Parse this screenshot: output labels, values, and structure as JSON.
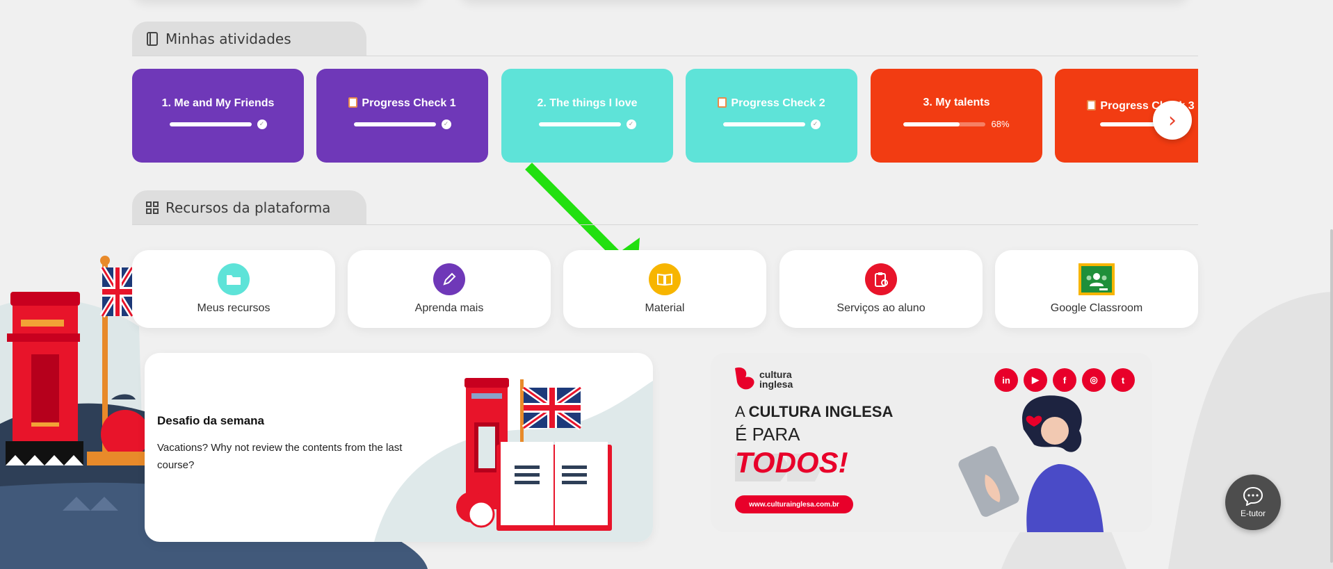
{
  "sections": {
    "activities_title": "Minhas atividades",
    "resources_title": "Recursos da plataforma"
  },
  "activities": [
    {
      "label": "1. Me and My Friends",
      "progress": 1.0,
      "done": true,
      "color": "#6f38b8",
      "doc": false
    },
    {
      "label": "Progress Check 1",
      "progress": 1.0,
      "done": true,
      "color": "#6f38b8",
      "doc": true
    },
    {
      "label": "2. The things I love",
      "progress": 1.0,
      "done": true,
      "color": "#5ee3d8",
      "doc": false
    },
    {
      "label": "Progress Check 2",
      "progress": 1.0,
      "done": true,
      "color": "#5ee3d8",
      "doc": true
    },
    {
      "label": "3. My talents",
      "progress": 0.68,
      "done": false,
      "percent_label": "68%",
      "color": "#f23c12",
      "doc": false
    },
    {
      "label": "Progress Check 3",
      "progress": 1.0,
      "done": false,
      "color": "#f23c12",
      "doc": true
    }
  ],
  "resources": [
    {
      "label": "Meus recursos",
      "icon": "folder-icon",
      "color": "#5ee3d8"
    },
    {
      "label": "Aprenda mais",
      "icon": "pencil-icon",
      "color": "#6f38b8"
    },
    {
      "label": "Material",
      "icon": "book-icon",
      "color": "#f7b500"
    },
    {
      "label": "Serviços ao aluno",
      "icon": "clipboard-icon",
      "color": "#e8142a"
    },
    {
      "label": "Google Classroom",
      "icon": "google-classroom-icon",
      "color": "#1f8f3a"
    }
  ],
  "challenge": {
    "title": "Desafio da semana",
    "text": "Vacations? Why not review the contents from the last course?"
  },
  "banner": {
    "logo_line1": "cultura",
    "logo_line2": "inglesa",
    "line1_prefix": "A ",
    "line1_bold": "CULTURA INGLESA",
    "line2": "É PARA",
    "line3": "TODOS!",
    "url": "www.culturainglesa.com.br",
    "socials": [
      "in",
      "▶",
      "f",
      "◎",
      "t"
    ]
  },
  "etutor_label": "E-tutor",
  "colors": {
    "accent": "#e8002a",
    "arrow": "#22e010"
  }
}
